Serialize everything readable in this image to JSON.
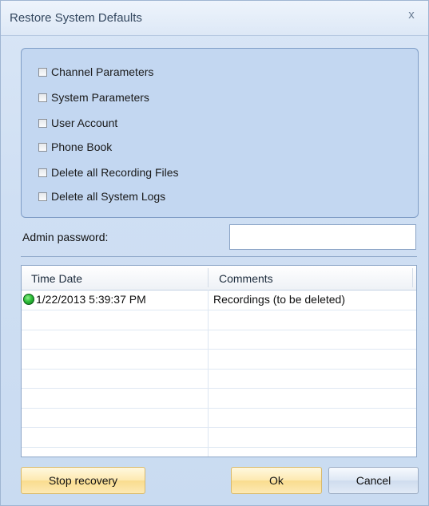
{
  "window": {
    "title": "Restore System Defaults",
    "close_glyph": "x"
  },
  "options": [
    {
      "label": "Channel Parameters",
      "checked": false
    },
    {
      "label": "System Parameters",
      "checked": false
    },
    {
      "label": "User Account",
      "checked": false
    },
    {
      "label": "Phone Book",
      "checked": false
    },
    {
      "label": "Delete all Recording Files",
      "checked": false
    },
    {
      "label": "Delete all System Logs",
      "checked": false
    }
  ],
  "password": {
    "label": "Admin password:",
    "value": ""
  },
  "table": {
    "columns": [
      "Time Date",
      "Comments"
    ],
    "rows": [
      {
        "status_icon": "green-status-icon",
        "time_date": "1/22/2013 5:39:37 PM",
        "comments": "Recordings (to be deleted)"
      }
    ]
  },
  "buttons": {
    "stop": "Stop recovery",
    "ok": "Ok",
    "cancel": "Cancel"
  }
}
